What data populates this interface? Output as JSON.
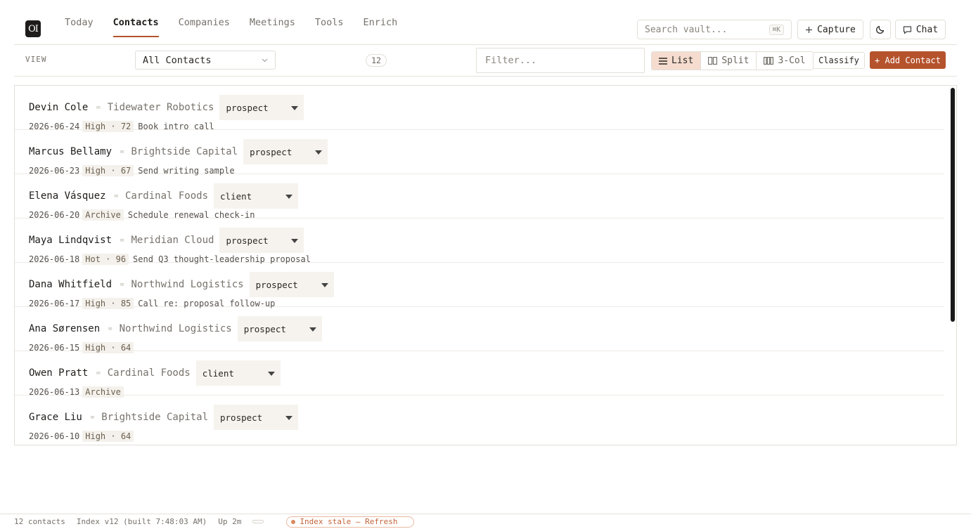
{
  "app": {
    "logo_text": "OI"
  },
  "nav": {
    "tabs": [
      {
        "label": "Today"
      },
      {
        "label": "Contacts"
      },
      {
        "label": "Companies"
      },
      {
        "label": "Meetings"
      },
      {
        "label": "Tools"
      },
      {
        "label": "Enrich"
      }
    ],
    "active": "Contacts"
  },
  "header": {
    "search_placeholder": "Search vault...",
    "search_shortcut": "⌘K",
    "capture_label": "Capture",
    "theme_icon": "moon-icon",
    "chat_label": "Chat"
  },
  "toolbar": {
    "view_label": "VIEW",
    "view_selected": "All Contacts",
    "count": "12",
    "filter_placeholder": "Filter...",
    "modes": [
      {
        "label": "List",
        "icon": "list-icon"
      },
      {
        "label": "Split",
        "icon": "split-icon"
      },
      {
        "label": "3-Col",
        "icon": "columns-icon"
      }
    ],
    "active_mode": "List",
    "classify_label": "Classify",
    "add_label": "+ Add Contact"
  },
  "contacts": [
    {
      "name": "Devin Cole",
      "company": "Tidewater Robotics",
      "status": "prospect",
      "date": "2026-06-24",
      "tag": "High · 72",
      "action": "Book intro call"
    },
    {
      "name": "Marcus Bellamy",
      "company": "Brightside Capital",
      "status": "prospect",
      "date": "2026-06-23",
      "tag": "High · 67",
      "action": "Send writing sample"
    },
    {
      "name": "Elena Vásquez",
      "company": "Cardinal Foods",
      "status": "client",
      "date": "2026-06-20",
      "tag": "Archive",
      "action": "Schedule renewal check-in"
    },
    {
      "name": "Maya Lindqvist",
      "company": "Meridian Cloud",
      "status": "prospect",
      "date": "2026-06-18",
      "tag": "Hot · 96",
      "action": "Send Q3 thought-leadership proposal"
    },
    {
      "name": "Dana Whitfield",
      "company": "Northwind Logistics",
      "status": "prospect",
      "date": "2026-06-17",
      "tag": "High · 85",
      "action": "Call re: proposal follow-up"
    },
    {
      "name": "Ana Sørensen",
      "company": "Northwind Logistics",
      "status": "prospect",
      "date": "2026-06-15",
      "tag": "High · 64",
      "action": ""
    },
    {
      "name": "Owen Pratt",
      "company": "Cardinal Foods",
      "status": "client",
      "date": "2026-06-13",
      "tag": "Archive",
      "action": ""
    },
    {
      "name": "Grace Liu",
      "company": "Brightside Capital",
      "status": "prospect",
      "date": "2026-06-10",
      "tag": "High · 64",
      "action": ""
    }
  ],
  "statusbar": {
    "contacts": "12 contacts",
    "index": "Index v12 (built 7:48:03 AM)",
    "uptime": "Up 2m",
    "stale": "Index stale — Refresh"
  }
}
